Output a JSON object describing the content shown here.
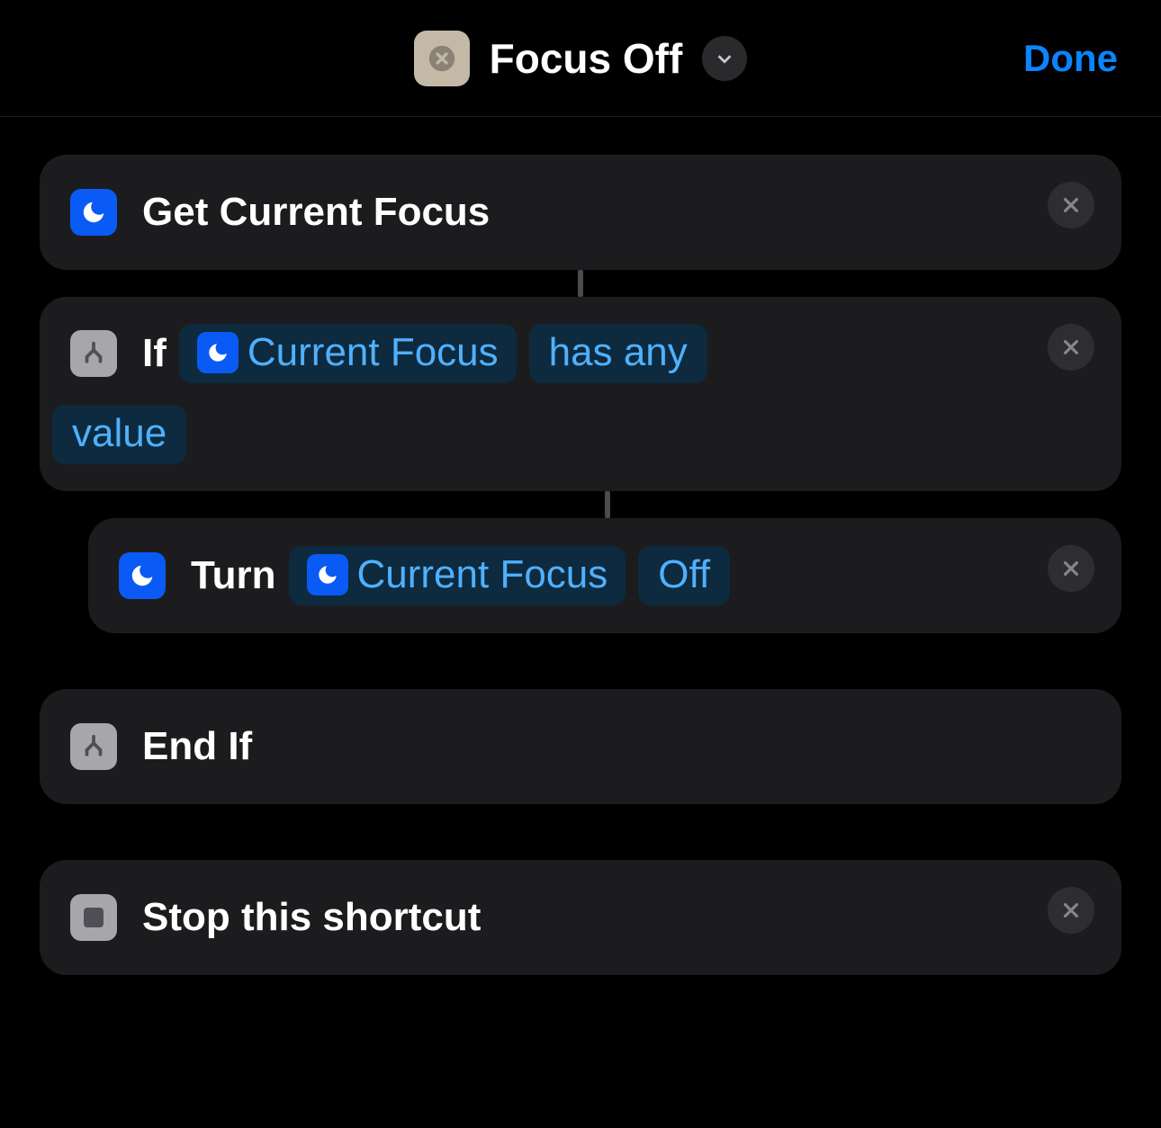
{
  "header": {
    "title": "Focus Off",
    "done": "Done"
  },
  "actions": {
    "getFocus": {
      "label": "Get Current Focus"
    },
    "ifBlock": {
      "prefix": "If",
      "var": "Current Focus",
      "condition1": "has any",
      "condition2": "value"
    },
    "turnFocus": {
      "verb": "Turn",
      "var": "Current Focus",
      "state": "Off"
    },
    "endIf": {
      "label": "End If"
    },
    "stop": {
      "label": "Stop this shortcut"
    }
  }
}
